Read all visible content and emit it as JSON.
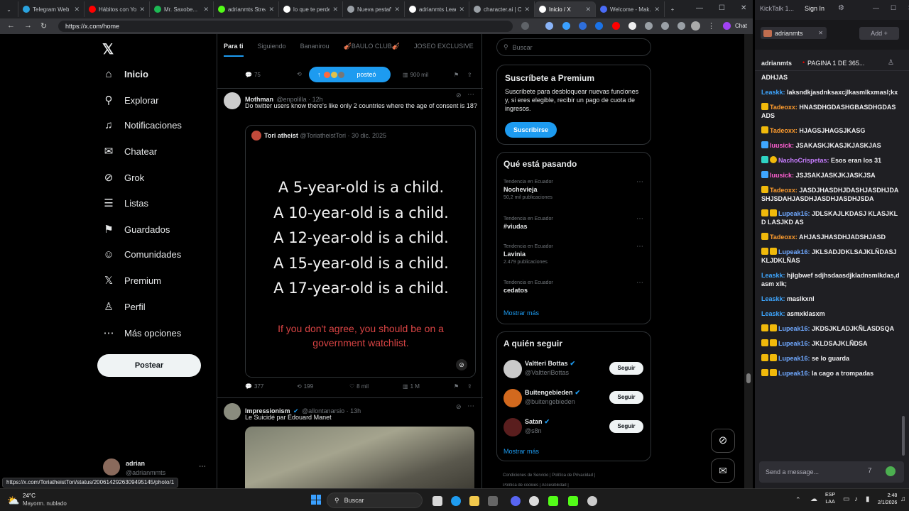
{
  "browser": {
    "tabs": [
      {
        "label": "Telegram Web",
        "color": "#2aa3df"
      },
      {
        "label": "Hábitos con Yo...",
        "color": "#ff0000"
      },
      {
        "label": "Mr. Saxobe...",
        "color": "#1db954"
      },
      {
        "label": "adrianmts Strea...",
        "color": "#53fc18"
      },
      {
        "label": "lo que te perde...",
        "color": "#ffffff"
      },
      {
        "label": "Nueva pestaña",
        "color": "#9aa0a6"
      },
      {
        "label": "adrianmts Leade...",
        "color": "#ffffff"
      },
      {
        "label": "character.ai | Ch...",
        "color": "#9aa0a6"
      },
      {
        "label": "Inicio / X",
        "color": "#ffffff"
      },
      {
        "label": "Welcome - Mak...",
        "color": "#4a6cf7"
      }
    ],
    "url": "https://x.com/home",
    "chat_label": "Chat",
    "status_url": "https://x.com/ToriatheistTori/status/2006142926309495145/photo/1"
  },
  "nav": {
    "items": [
      {
        "label": "Inicio",
        "icon": "home-icon",
        "glyph": "⌂"
      },
      {
        "label": "Explorar",
        "icon": "search-icon",
        "glyph": "⚲"
      },
      {
        "label": "Notificaciones",
        "icon": "bell-icon",
        "glyph": "♫"
      },
      {
        "label": "Chatear",
        "icon": "mail-icon",
        "glyph": "✉"
      },
      {
        "label": "Grok",
        "icon": "grok-icon",
        "glyph": "⊘"
      },
      {
        "label": "Listas",
        "icon": "list-icon",
        "glyph": "☰"
      },
      {
        "label": "Guardados",
        "icon": "bookmark-icon",
        "glyph": "⚑"
      },
      {
        "label": "Comunidades",
        "icon": "people-icon",
        "glyph": "☺"
      },
      {
        "label": "Premium",
        "icon": "x-logo-icon",
        "glyph": "𝕏"
      },
      {
        "label": "Perfil",
        "icon": "person-icon",
        "glyph": "♙"
      },
      {
        "label": "Más opciones",
        "icon": "more-icon",
        "glyph": "⋯"
      }
    ],
    "post_label": "Postear",
    "account_name": "adrian",
    "account_handle": "@adrianmmts"
  },
  "feed": {
    "tabs": [
      "Para ti",
      "Siguiendo",
      "Bananirou",
      "🎻BAULO CLUB🎻",
      "JOSEO EXCLUSIVE"
    ],
    "posted_pill": "posteó",
    "top_actions": {
      "replies": "75",
      "views": "900 mil"
    },
    "tweet1": {
      "name": "Mothman",
      "handle": "@enpolilla · 12h",
      "text": "Do twitter users know there's like only 2 countries where the age of consent is 18?",
      "quote_name": "Tori atheist",
      "quote_handle": "@ToriatheistTori · 30 dic. 2025",
      "image_lines": [
        "A 5-year-old is a child.",
        "A 10-year-old is a child.",
        "A 12-year-old is a child.",
        "A 15-year-old is a child.",
        "A 17-year-old is a child."
      ],
      "image_warning": "If you don't agree, you should be on a government watchlist.",
      "replies": "377",
      "reposts": "199",
      "likes": "8 mil",
      "views": "1 M"
    },
    "tweet2": {
      "name": "Impressionism",
      "handle": "@allontanarsio · 13h",
      "text": "Le Suicidé par Édouard Manet"
    }
  },
  "right": {
    "search_placeholder": "Buscar",
    "premium": {
      "title": "Suscríbete a Premium",
      "body": "Suscríbete para desbloquear nuevas funciones y, si eres elegible, recibir un pago de cuota de ingresos.",
      "button": "Suscribirse"
    },
    "trends": {
      "title": "Qué está pasando",
      "items": [
        {
          "sub": "Tendencia en Ecuador",
          "name": "Nochevieja",
          "count": "50,2 mil publicaciones"
        },
        {
          "sub": "Tendencia en Ecuador",
          "name": "#viudas",
          "count": ""
        },
        {
          "sub": "Tendencia en Ecuador",
          "name": "Lavinia",
          "count": "2.479 publicaciones"
        },
        {
          "sub": "Tendencia en Ecuador",
          "name": "cedatos",
          "count": ""
        }
      ],
      "more": "Mostrar más"
    },
    "follow": {
      "title": "A quién seguir",
      "items": [
        {
          "name": "Valtteri Bottas",
          "handle": "@ValtteriBottas",
          "button": "Seguir"
        },
        {
          "name": "Buitengebieden",
          "handle": "@buitengebieden",
          "button": "Seguir"
        },
        {
          "name": "Satan",
          "handle": "@s8n",
          "button": "Seguir"
        }
      ],
      "more": "Mostrar más"
    },
    "footer": "Condiciones de Servicio | Política de Privacidad |",
    "footer2": "Política de cookies | Accesibilidad |"
  },
  "chat": {
    "app": "KickTalk 1...",
    "sign_in": "Sign In",
    "tab": "adrianmts",
    "add": "Add",
    "header_user": "adrianmts",
    "header_status": "PAGINA 1 DE 365...",
    "input_placeholder": "Send a message...",
    "messages": [
      {
        "user": "",
        "text": "ADHJAS",
        "color": "#efeff1"
      },
      {
        "user": "Leaskk:",
        "text": "laksndkjasdnksaxcjlkasmlkxmasl;kx",
        "color": "#3ea6ff"
      },
      {
        "user": "Tadeoxx:",
        "text": "HNASDHGDASHGBASDHGDASADS",
        "color": "#ff9d2e"
      },
      {
        "user": "Tadeoxx:",
        "text": "HJAGSJHAGSJKASG",
        "color": "#ff9d2e"
      },
      {
        "user": "luusick:",
        "text": "JSAKASKJKASJKJASKJAS",
        "color": "#ff5fd2"
      },
      {
        "user": "NachoCrispetas:",
        "text": "Esos eran los 31",
        "color": "#c77dff"
      },
      {
        "user": "luusick:",
        "text": "JSJSAKJASKJKJASKJSA",
        "color": "#ff5fd2"
      },
      {
        "user": "Tadeoxx:",
        "text": "JASDJHASDHJDASHJASDHJDASHJSDAHJASDHJASDHJASDHJSDA",
        "color": "#ff9d2e"
      },
      {
        "user": "Lupeak16:",
        "text": "JDLSKAJLKDASJ KLASJKLD LASJKD AS",
        "color": "#6fa8ff"
      },
      {
        "user": "Tadeoxx:",
        "text": "AHJASJHASDHJADSHJASD",
        "color": "#ff9d2e"
      },
      {
        "user": "Lupeak16:",
        "text": "JKLSADJDKLSAJKLÑDASJKLJDKLÑAS",
        "color": "#6fa8ff"
      },
      {
        "user": "Leaskk:",
        "text": "hjlgbwef sdjhsdaasdjkladnsmlkdas,dasm xlk;",
        "color": "#3ea6ff"
      },
      {
        "user": "Leaskk:",
        "text": "maslkxnl",
        "color": "#3ea6ff"
      },
      {
        "user": "Leaskk:",
        "text": "asmxklasxm",
        "color": "#3ea6ff"
      },
      {
        "user": "Lupeak16:",
        "text": "JKDSJKLADJKÑLASDSQA",
        "color": "#6fa8ff"
      },
      {
        "user": "Lupeak16:",
        "text": "JKLDSAJKLÑDSA",
        "color": "#6fa8ff"
      },
      {
        "user": "Lupeak16:",
        "text": "se lo guarda",
        "color": "#6fa8ff"
      },
      {
        "user": "Lupeak16:",
        "text": "la cago a trompadas",
        "color": "#6fa8ff"
      }
    ]
  },
  "taskbar": {
    "weather_temp": "24°C",
    "weather_desc": "Mayorm. nublado",
    "search": "Buscar",
    "lang": "ESP",
    "lang2": "LAA",
    "time": "2:48",
    "date": "2/1/2026"
  }
}
